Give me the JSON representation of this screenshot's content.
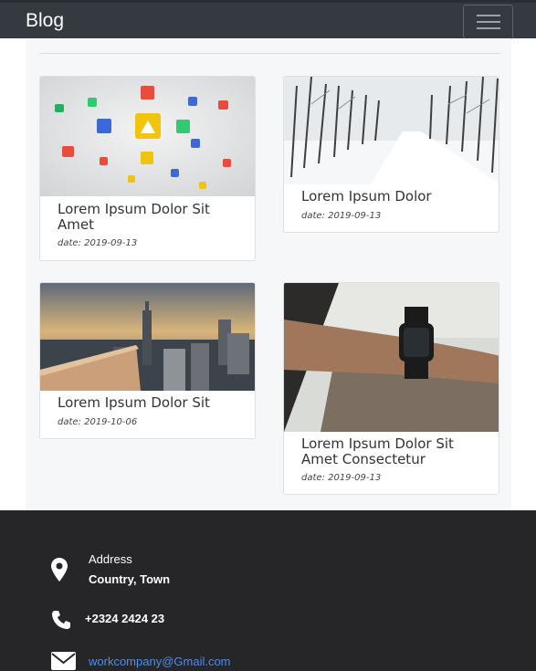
{
  "navbar": {
    "brand": "Blog",
    "menu_icon": "hamburger-icon"
  },
  "posts": [
    {
      "title": "Lorem Ipsum Dolor Sit Amet",
      "date": "date: 2019-09-13",
      "image": "apps-icons-image"
    },
    {
      "title": "Lorem Ipsum Dolor",
      "date": "date: 2019-09-13",
      "image": "snowy-road-image"
    },
    {
      "title": "Lorem Ipsum Dolor Sit",
      "date": "date: 2019-10-06",
      "image": "city-skyline-image"
    },
    {
      "title": "Lorem Ipsum Dolor Sit Amet Consectetur",
      "date": "date: 2019-09-13",
      "image": "smartwatch-image"
    }
  ],
  "footer": {
    "address_label": "Address",
    "address_value": "Country, Town",
    "phone": "+2324 2424 23",
    "email": "workcompany@Gmail.com",
    "icons": [
      "map-pin-icon",
      "phone-icon",
      "envelope-icon"
    ]
  },
  "colors": {
    "navbar": "#343a40",
    "footer": "#262628",
    "link": "#4d8ee8",
    "content_bg": "#f6f7f9"
  }
}
